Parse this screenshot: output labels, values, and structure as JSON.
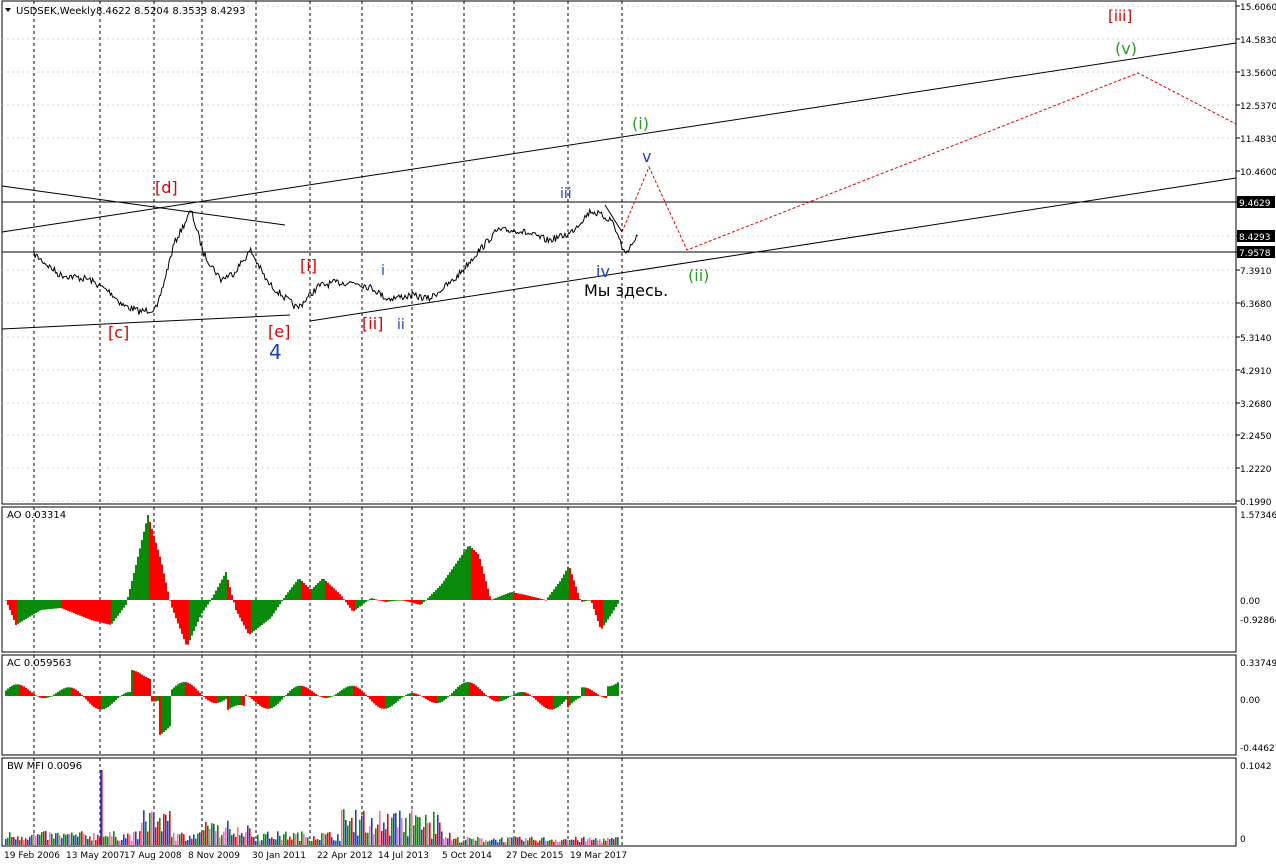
{
  "window": {
    "symbol_label": "USDSEK,Weekly",
    "ohlc": "8.4622 8.5204 8.3533 8.4293"
  },
  "panels": {
    "main": {
      "ticks": [
        "15.6060",
        "14.5830",
        "13.5600",
        "12.5370",
        "11.4830",
        "10.4600",
        "9.4629",
        "8.4293",
        "7.9578",
        "7.3910",
        "6.3680",
        "5.3140",
        "4.2910",
        "3.2680",
        "2.2450",
        "1.2220",
        "0.1990"
      ],
      "highlight_ticks": [
        "9.4629",
        "8.4293",
        "7.9578"
      ]
    },
    "ao": {
      "label": "AO 0.03314",
      "ticks": [
        "1.57346",
        "0.00",
        "-0.92864"
      ]
    },
    "ac": {
      "label": "AC 0.059563",
      "ticks": [
        "0.337493",
        "0.00",
        "-0.44627"
      ]
    },
    "mfi": {
      "label": "BW MFI 0.0096",
      "ticks": [
        "0.1042",
        "0"
      ]
    }
  },
  "x_axis": {
    "dates": [
      "19 Feb 2006",
      "13 May 2007",
      "17 Aug 2008",
      "8 Nov 2009",
      "30 Jan 2011",
      "22 Apr 2012",
      "14 Jul 2013",
      "5 Oct 2014",
      "27 Dec 2015",
      "19 Mar 2017"
    ]
  },
  "wave_labels": [
    {
      "text": "[iii]",
      "color": "#e00000"
    },
    {
      "text": "(v)",
      "color": "#2a9a2a"
    },
    {
      "text": "(i)",
      "color": "#2a9a2a"
    },
    {
      "text": "v",
      "color": "#1a3fd0"
    },
    {
      "text": "iii",
      "color": "#1a3fd0"
    },
    {
      "text": "[d]",
      "color": "#e00000"
    },
    {
      "text": "[i]",
      "color": "#e00000"
    },
    {
      "text": "i",
      "color": "#1a3fd0"
    },
    {
      "text": "iv",
      "color": "#1a3fd0"
    },
    {
      "text": "(ii)",
      "color": "#2a9a2a"
    },
    {
      "text": "[c]",
      "color": "#e00000"
    },
    {
      "text": "[e]",
      "color": "#e00000"
    },
    {
      "text": "4",
      "color": "#1a3fd0"
    },
    {
      "text": "[ii]",
      "color": "#e00000"
    },
    {
      "text": "ii",
      "color": "#1a3fd0"
    }
  ],
  "annotation": {
    "text": "Мы здесь."
  },
  "colors": {
    "bull": "#0a8a0a",
    "bear": "#ff0000",
    "projection": "#e00000"
  },
  "chart_data": {
    "type": "line",
    "title": "USDSEK,Weekly",
    "x_range": [
      "2006-02-19",
      "2017-03-19+"
    ],
    "price_path": [
      [
        "2006-02",
        7.9
      ],
      [
        "2006-08",
        7.25
      ],
      [
        "2007-03",
        7.1
      ],
      [
        "2007-08",
        6.7
      ],
      [
        "2007-11",
        6.3
      ],
      [
        "2008-03",
        6.1
      ],
      [
        "2008-07",
        6.2
      ],
      [
        "2008-11",
        8.2
      ],
      [
        "2009-03",
        9.2
      ],
      [
        "2009-06",
        7.9
      ],
      [
        "2009-10",
        7.1
      ],
      [
        "2010-01",
        7.3
      ],
      [
        "2010-05",
        8.0
      ],
      [
        "2010-09",
        7.0
      ],
      [
        "2011-04",
        6.2
      ],
      [
        "2011-09",
        6.9
      ],
      [
        "2012-01",
        7.0
      ],
      [
        "2012-06",
        7.0
      ],
      [
        "2012-10",
        6.8
      ],
      [
        "2013-01",
        6.5
      ],
      [
        "2013-07",
        6.6
      ],
      [
        "2013-11",
        6.5
      ],
      [
        "2014-05",
        7.1
      ],
      [
        "2014-10",
        7.9
      ],
      [
        "2015-03",
        8.6
      ],
      [
        "2015-08",
        8.6
      ],
      [
        "2016-03",
        8.3
      ],
      [
        "2016-08",
        8.5
      ],
      [
        "2017-01",
        9.2
      ],
      [
        "2017-06",
        8.9
      ],
      [
        "2017-09",
        7.9
      ],
      [
        "2017-12",
        8.43
      ]
    ],
    "ylim": [
      0.199,
      15.606
    ],
    "horizontal_levels": [
      9.4629,
      7.9578
    ],
    "ao_range": [
      -0.92864,
      1.57346
    ],
    "ac_range": [
      -0.44627,
      0.337493
    ],
    "mfi_range": [
      0,
      0.1042
    ]
  }
}
